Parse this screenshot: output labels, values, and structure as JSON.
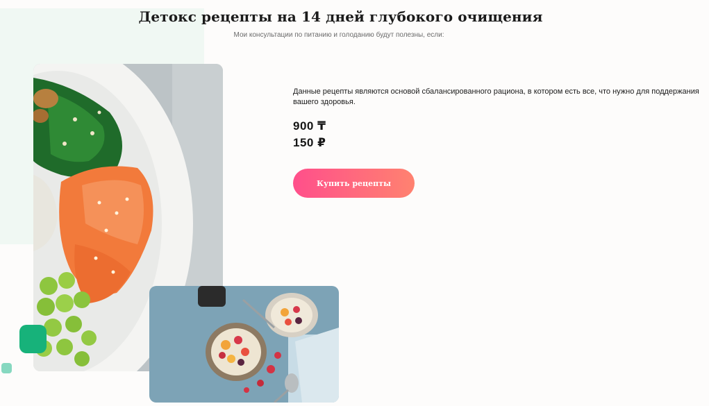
{
  "header": {
    "title": "Детокс рецепты на 14 дней глубокого очищения",
    "subtitle": "Мои консультации по питанию и голоданию будут полезны, если:"
  },
  "content": {
    "description": "Данные рецепты являются основой сбалансированного рациона, в котором есть все, что нужно для поддержания вашего здоровья.",
    "price_kzt": "900 ₸",
    "price_rub": "150 ₽",
    "buy_label": "Купить рецепты"
  },
  "images": {
    "main": "poke-bowl-salmon-photo",
    "secondary": "fruit-oatmeal-bowls-photo"
  },
  "colors": {
    "accent_gradient_start": "#ff4f8b",
    "accent_gradient_end": "#ff8270",
    "green_accent": "#17b27a",
    "light_green_accent": "#86d8c0",
    "panel_background": "#f0f8f3"
  }
}
